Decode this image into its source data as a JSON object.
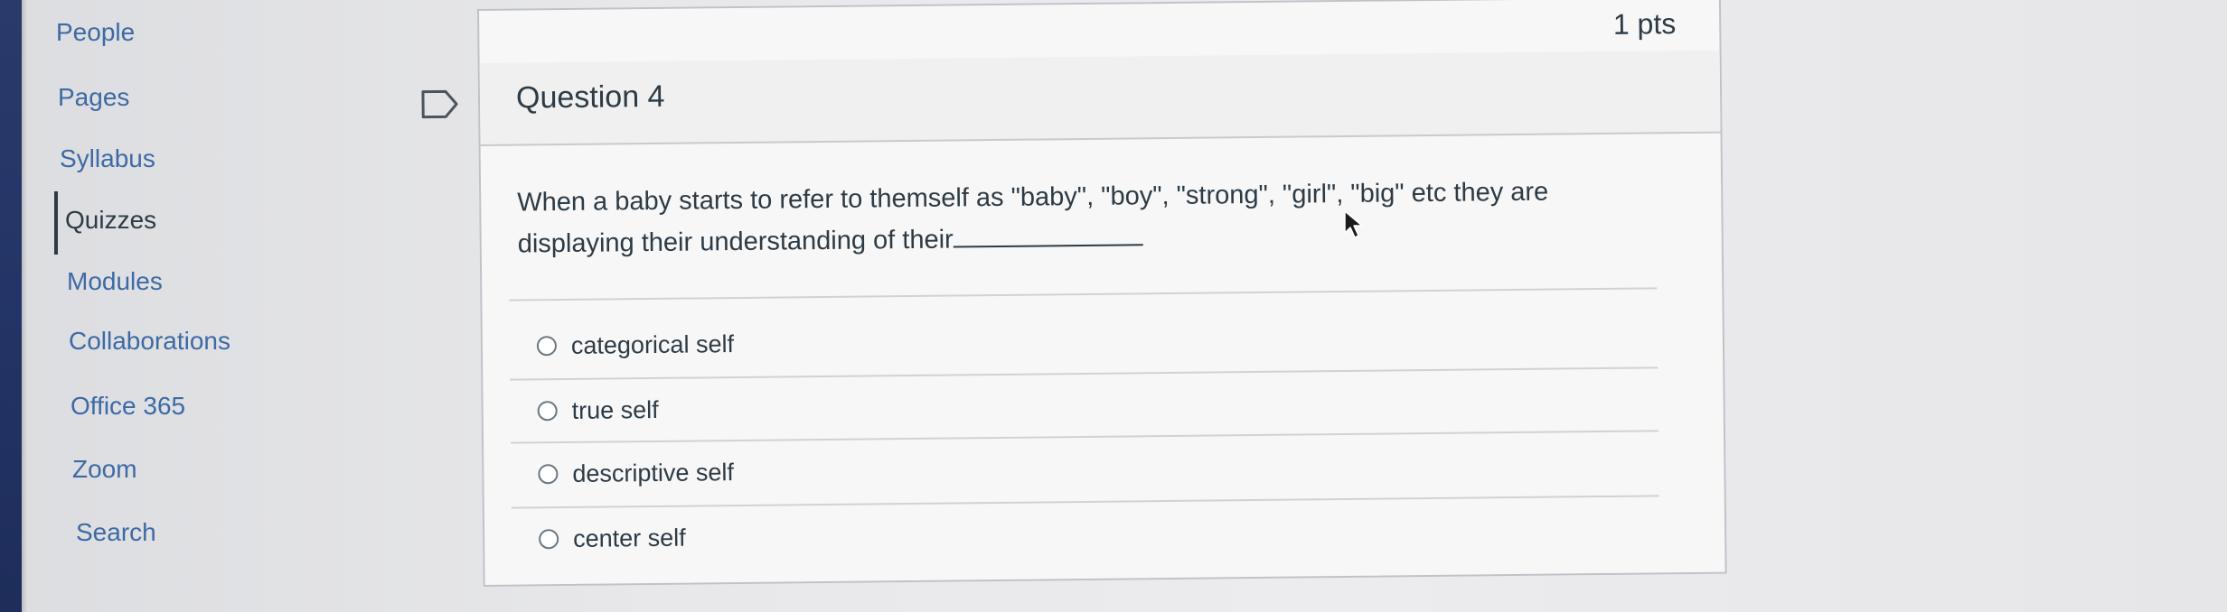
{
  "course_nav": {
    "items": [
      {
        "label": "People"
      },
      {
        "label": "Pages"
      },
      {
        "label": "Syllabus"
      },
      {
        "label": "Quizzes",
        "active": true
      },
      {
        "label": "Modules"
      },
      {
        "label": "Collaborations"
      },
      {
        "label": "Office 365"
      },
      {
        "label": "Zoom"
      },
      {
        "label": "Search"
      }
    ]
  },
  "question": {
    "title": "Question 4",
    "points": "1 pts",
    "text_line1": "When a baby starts to refer to themself as \"baby\", \"boy\", \"strong\", \"girl\", \"big\" etc they are",
    "text_line2": "displaying their understanding of their",
    "answers": [
      {
        "label": "categorical self"
      },
      {
        "label": "true self"
      },
      {
        "label": "descriptive self"
      },
      {
        "label": "center self"
      }
    ]
  },
  "colors": {
    "link": "#3d6aa5",
    "text": "#2d3b45",
    "border": "#bfc3c8",
    "sidebar_edge": "#233466"
  }
}
